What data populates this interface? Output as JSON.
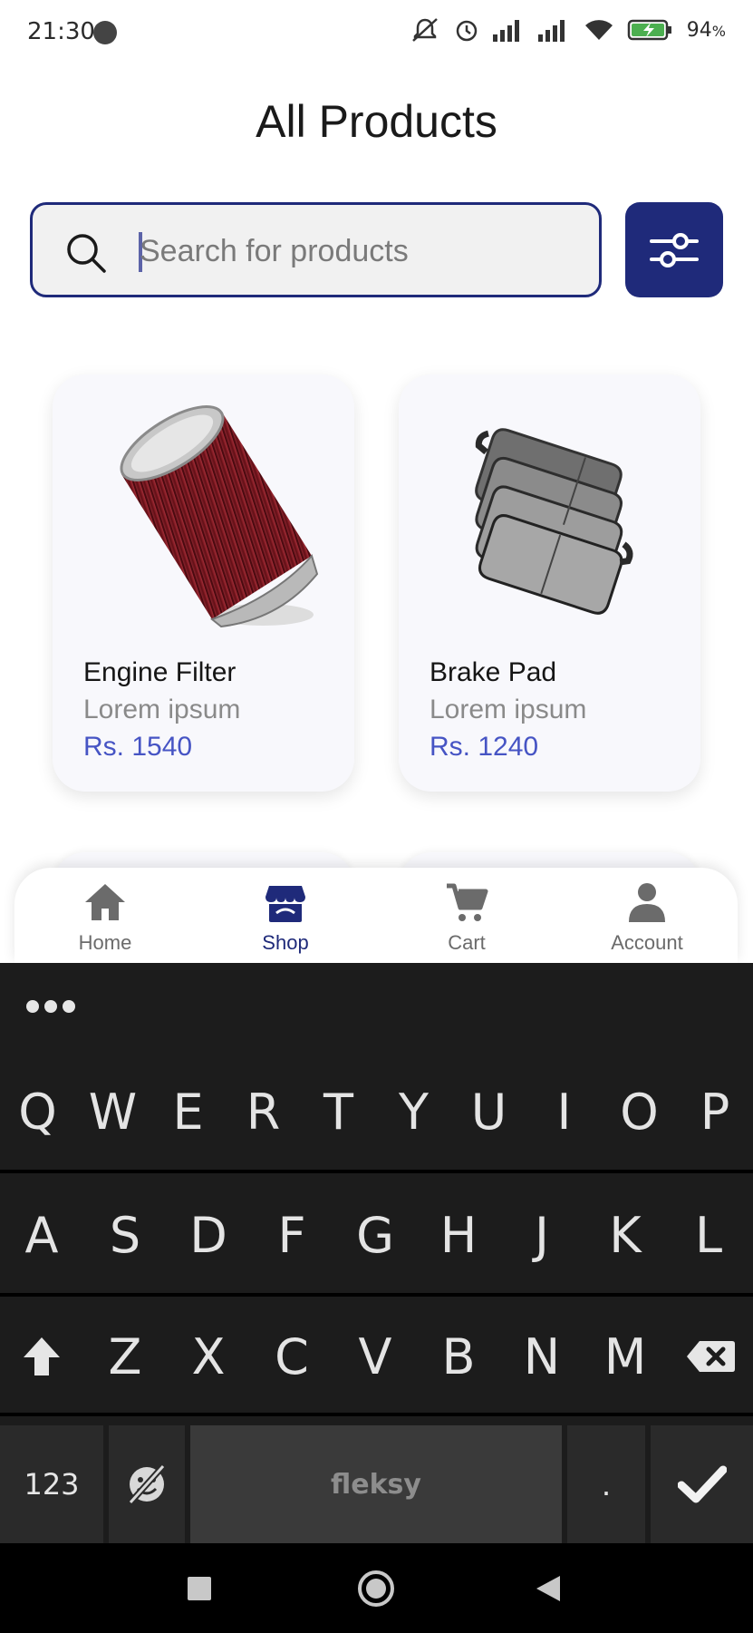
{
  "status_bar": {
    "time": "21:30",
    "battery_percent": "94",
    "battery_percent_suffix": "%",
    "icons": [
      "mute-icon",
      "alarm-icon",
      "signal-icon",
      "signal-icon",
      "wifi-icon",
      "battery-charging-icon"
    ]
  },
  "header": {
    "title": "All Products"
  },
  "search": {
    "placeholder": "Search for products",
    "value": ""
  },
  "colors": {
    "primary": "#1f2a7a",
    "price": "#4654c4",
    "keyboard_bg": "#1c1c1c"
  },
  "products": [
    {
      "name": "Engine Filter",
      "description": "Lorem ipsum",
      "price": "Rs. 1540",
      "image": "engine-filter"
    },
    {
      "name": "Brake Pad",
      "description": "Lorem ipsum",
      "price": "Rs. 1240",
      "image": "brake-pad"
    }
  ],
  "bottom_nav": {
    "active": "Shop",
    "items": [
      {
        "label": "Home",
        "icon": "home-icon"
      },
      {
        "label": "Shop",
        "icon": "shop-icon"
      },
      {
        "label": "Cart",
        "icon": "cart-icon"
      },
      {
        "label": "Account",
        "icon": "account-icon"
      }
    ]
  },
  "keyboard": {
    "row1": [
      "Q",
      "W",
      "E",
      "R",
      "T",
      "Y",
      "U",
      "I",
      "O",
      "P"
    ],
    "row2": [
      "A",
      "S",
      "D",
      "F",
      "G",
      "H",
      "J",
      "K",
      "L"
    ],
    "row3": [
      "Z",
      "X",
      "C",
      "V",
      "B",
      "N",
      "M"
    ],
    "numbers_key": "123",
    "space_label": "fleksy",
    "period_key": "."
  }
}
